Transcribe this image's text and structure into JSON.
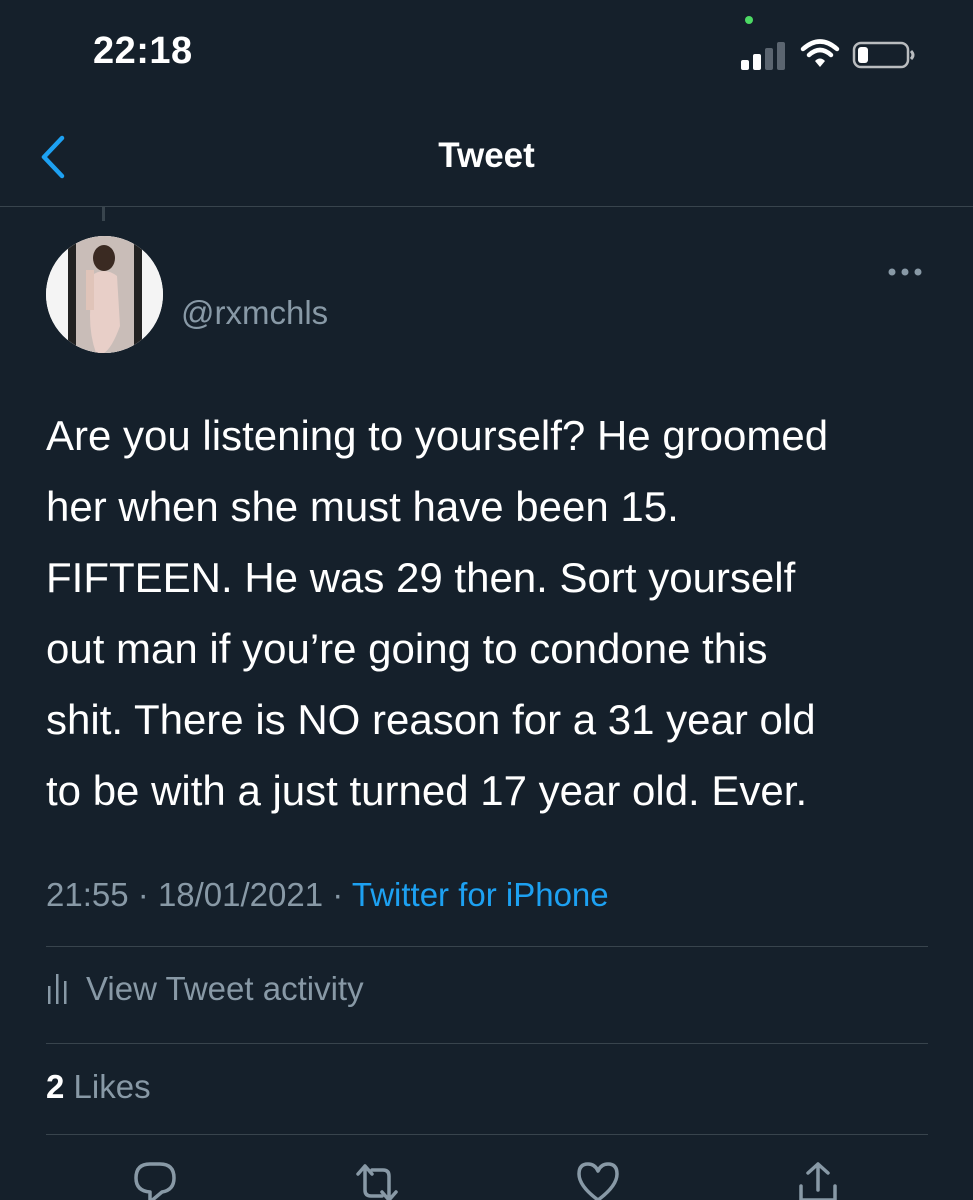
{
  "status_bar": {
    "time": "22:18",
    "icons": [
      "signal-icon",
      "wifi-icon",
      "battery-icon"
    ],
    "indicator_color": "#4cd964"
  },
  "nav": {
    "title": "Tweet",
    "back_icon": "chevron-left-icon"
  },
  "tweet": {
    "handle": "@rxmchls",
    "text": "Are you listening to yourself? He groomed\nher when she must have been 15.\nFIFTEEN.  He was 29 then. Sort yourself\nout man if you’re going to condone this\nshit. There is NO reason for a 31 year old\nto be with a just turned 17 year old. Ever.",
    "time": "21:55",
    "date": "18/01/2021",
    "separator": "·",
    "source": "Twitter for iPhone",
    "activity_label": "View Tweet activity",
    "likes_count": "2",
    "likes_label": "Likes",
    "actions": [
      "reply-icon",
      "retweet-icon",
      "like-icon",
      "share-icon"
    ]
  },
  "colors": {
    "background": "#15202b",
    "accent": "#1da1f2",
    "secondary_text": "#8899a6",
    "divider": "#38444d"
  }
}
